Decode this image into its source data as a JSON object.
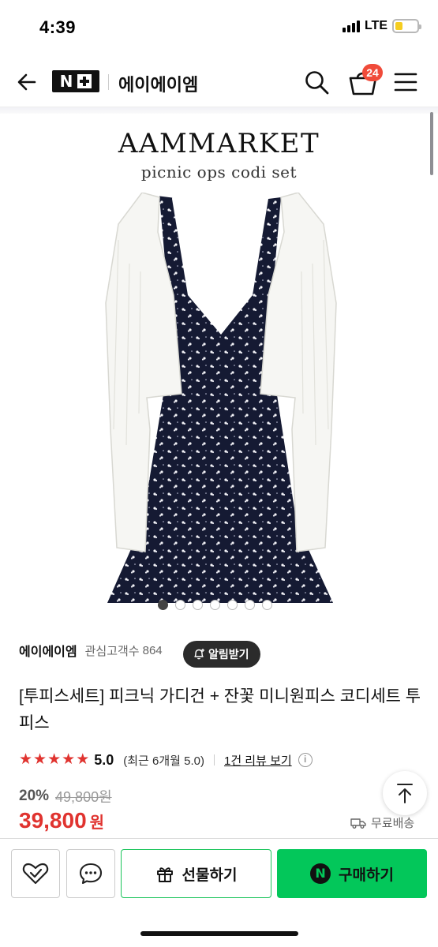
{
  "status_bar": {
    "time": "4:39",
    "network": "LTE",
    "battery_level": 0.35
  },
  "header": {
    "logo_text": "N",
    "store_name": "에이에이엠",
    "cart_count": "24",
    "icons": {
      "back": "back-arrow-icon",
      "search": "search-icon",
      "cart": "shopping-bag-icon",
      "menu": "hamburger-menu-icon"
    }
  },
  "product_image": {
    "brand": "AAMMARKET",
    "subtitle": "picnic ops codi set",
    "image_count": 7,
    "active_index": 0
  },
  "seller": {
    "name": "에이에이엠",
    "interest_label": "관심고객수",
    "interest_count": "864",
    "notify_label": "알림받기"
  },
  "product": {
    "title": "[투피스세트] 피크닉 가디건 + 잔꽃 미니원피스 코디세트 투피스",
    "rating_stars": 5,
    "rating_value": "5.0",
    "rating_recent": "(최근 6개월 5.0)",
    "review_link": "1건 리뷰 보기",
    "discount": "20%",
    "original_price": "49,800원",
    "price": "39,800",
    "price_unit": "원",
    "shipping": "무료배송"
  },
  "actions": {
    "gift_label": "선물하기",
    "buy_label": "구매하기",
    "npay_mark": "N"
  },
  "colors": {
    "accent_green": "#03c75a",
    "price_red": "#e0332f",
    "badge_red": "#f04b3a"
  }
}
